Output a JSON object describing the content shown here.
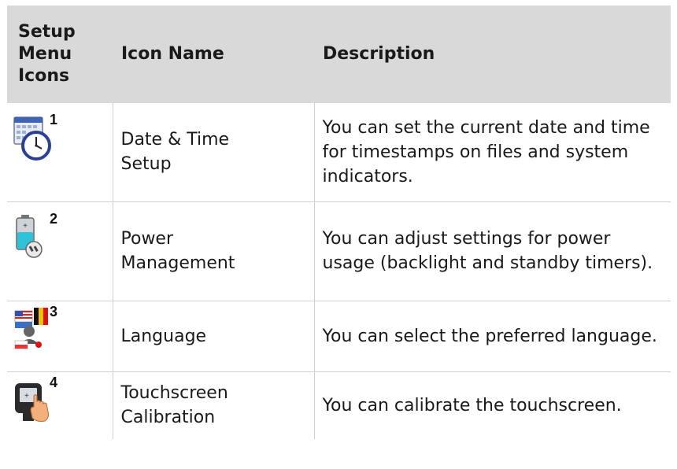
{
  "header": {
    "col1": "Setup Menu Icons",
    "col1_lines": [
      "Setup",
      "Menu",
      "Icons"
    ],
    "col2": "Icon Name",
    "col3": "Description"
  },
  "rows": [
    {
      "icon": "calendar-clock-icon",
      "number": "1",
      "name_lines": [
        "Date & Time",
        "Setup"
      ],
      "description": "You can set the current date and time for timestamps on files and system indicators."
    },
    {
      "icon": "battery-plug-icon",
      "number": "2",
      "name_lines": [
        "Power",
        "Management"
      ],
      "description": "You can adjust settings for power usage (backlight and standby timers)."
    },
    {
      "icon": "flags-person-icon",
      "number": "3",
      "name_lines": [
        "Language"
      ],
      "description": "You can select the preferred language."
    },
    {
      "icon": "touchscreen-hand-icon",
      "number": "4",
      "name_lines": [
        "Touchscreen",
        "Calibration"
      ],
      "description": "You can calibrate the touchscreen."
    }
  ],
  "colors": {
    "header_bg": "#d9d9d9",
    "grid_line": "#cfcfcf",
    "text": "#1a1a1a"
  }
}
